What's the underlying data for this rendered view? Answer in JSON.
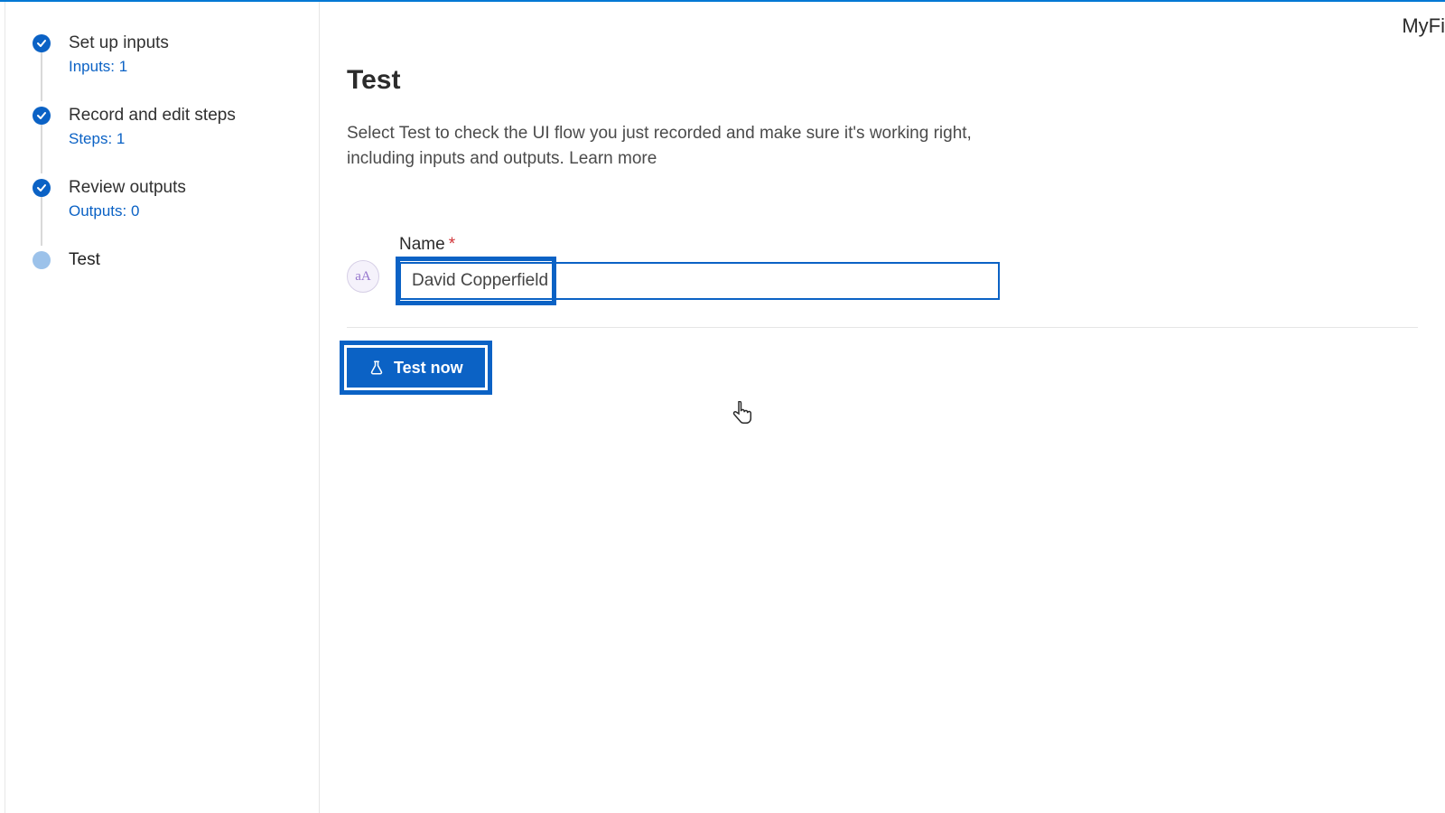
{
  "brand": "MyFi",
  "sidebar": {
    "steps": [
      {
        "title": "Set up inputs",
        "sub": "Inputs: 1",
        "state": "done"
      },
      {
        "title": "Record and edit steps",
        "sub": "Steps: 1",
        "state": "done"
      },
      {
        "title": "Review outputs",
        "sub": "Outputs: 0",
        "state": "done"
      },
      {
        "title": "Test",
        "sub": "",
        "state": "current"
      }
    ]
  },
  "main": {
    "title": "Test",
    "description": "Select Test to check the UI flow you just recorded and make sure it's working right, including inputs and outputs. ",
    "learn_more": "Learn more",
    "field": {
      "type_badge": "aA",
      "label": "Name",
      "required_mark": "*",
      "value": "David Copperfield"
    },
    "test_button": "Test now"
  }
}
